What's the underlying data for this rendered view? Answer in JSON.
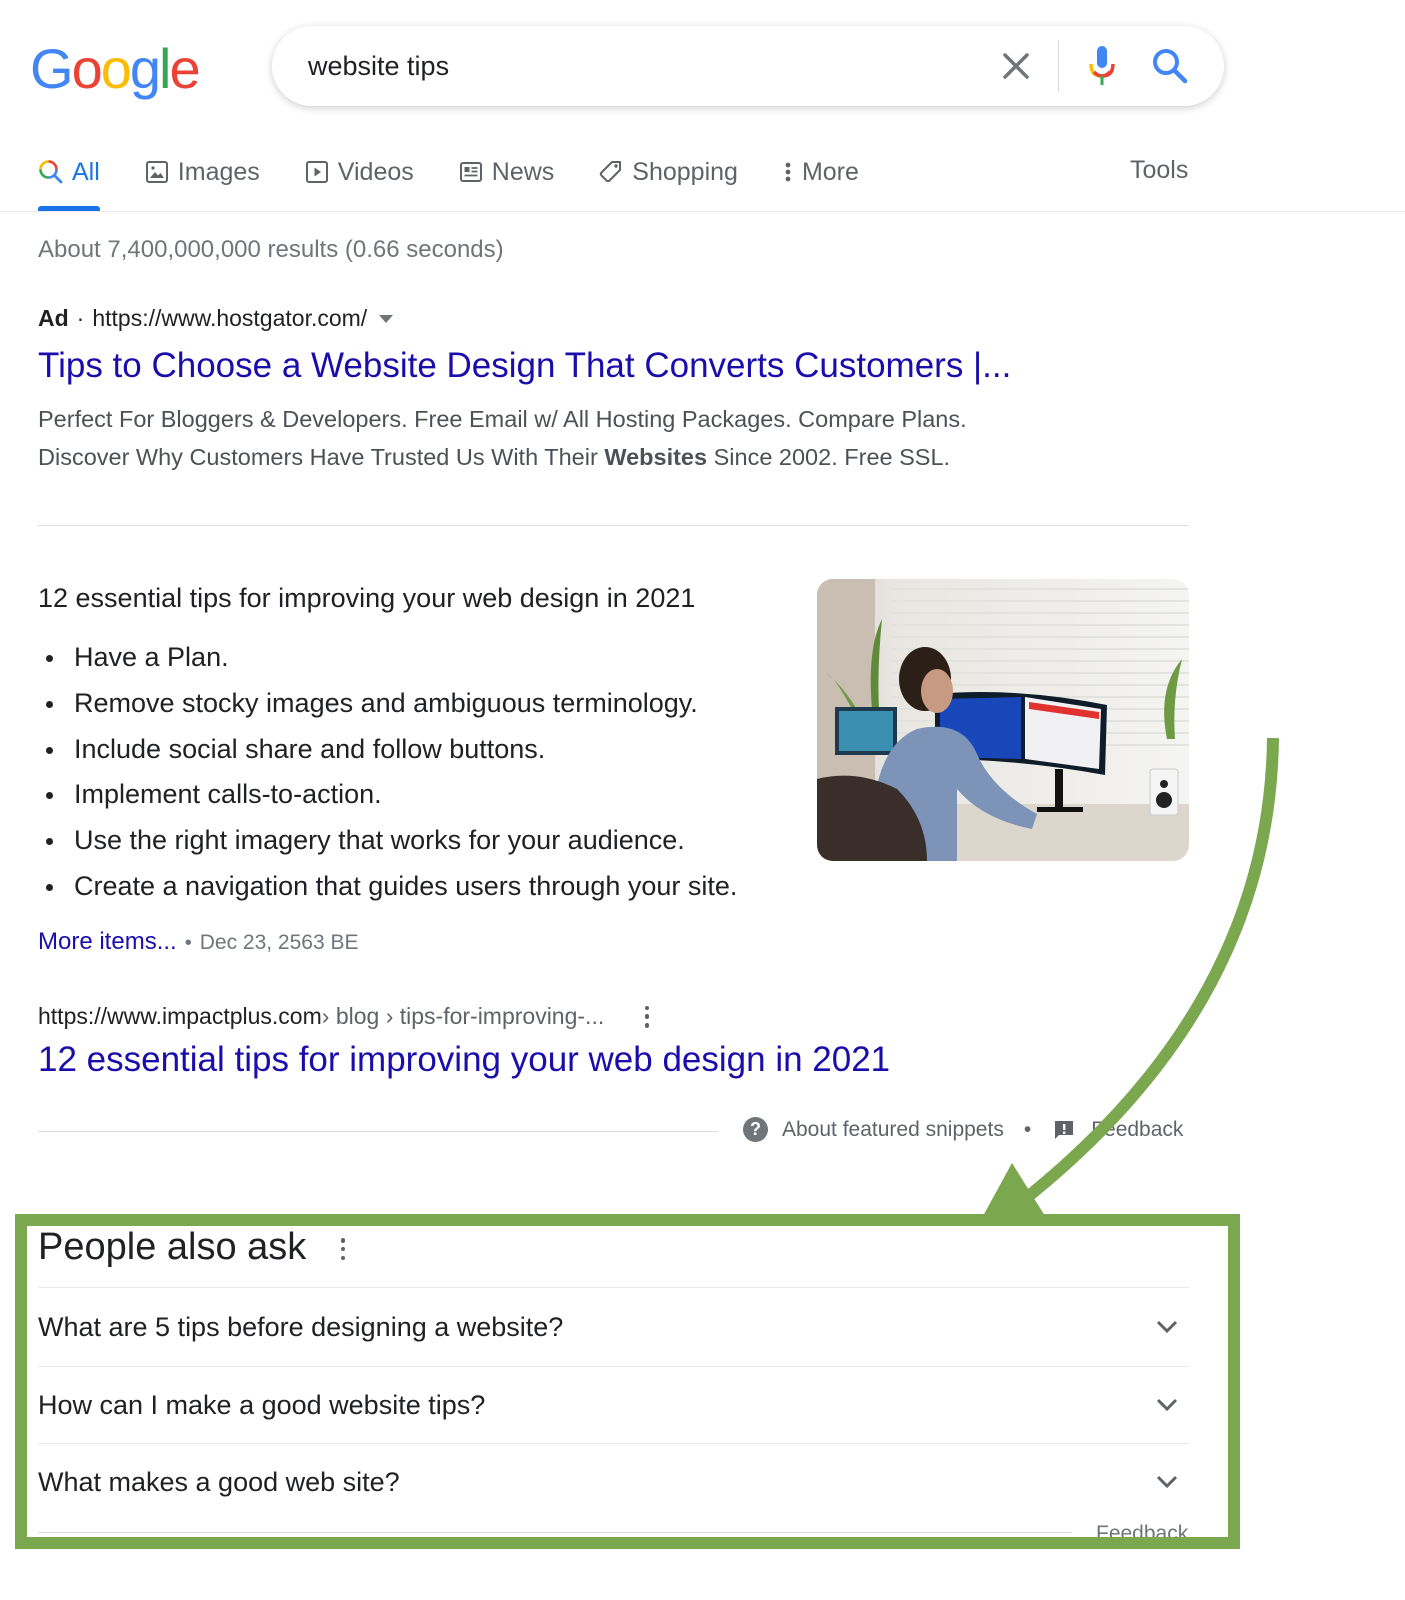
{
  "header": {
    "logo_letters": [
      {
        "char": "G",
        "color": "#4285F4"
      },
      {
        "char": "o",
        "color": "#EA4335"
      },
      {
        "char": "o",
        "color": "#FBBC05"
      },
      {
        "char": "g",
        "color": "#4285F4"
      },
      {
        "char": "l",
        "color": "#34A853"
      },
      {
        "char": "e",
        "color": "#EA4335"
      }
    ],
    "search_query": "website tips",
    "icons": {
      "clear": "close-icon",
      "voice": "microphone-icon",
      "search": "search-icon"
    }
  },
  "tabs": [
    {
      "label": "All",
      "icon": "search-icon",
      "active": true
    },
    {
      "label": "Images",
      "icon": "image-icon",
      "active": false
    },
    {
      "label": "Videos",
      "icon": "play-icon",
      "active": false
    },
    {
      "label": "News",
      "icon": "newspaper-icon",
      "active": false
    },
    {
      "label": "Shopping",
      "icon": "tag-icon",
      "active": false
    },
    {
      "label": "More",
      "icon": "more-vert-icon",
      "active": false
    }
  ],
  "tools_label": "Tools",
  "result_stats": "About 7,400,000,000 results (0.66 seconds)",
  "ad": {
    "badge": "Ad",
    "separator": "·",
    "url": "https://www.hostgator.com/",
    "title": "Tips to Choose a Website Design That Converts Customers |...",
    "description_line1": "Perfect For Bloggers & Developers. Free Email w/ All Hosting Packages. Compare Plans.",
    "description_line2_before": "Discover Why Customers Have Trusted Us With Their ",
    "description_line2_bold": "Websites",
    "description_line2_after": " Since 2002. Free SSL."
  },
  "featured_snippet": {
    "heading": "12 essential tips for improving your web design in 2021",
    "items": [
      "Have a Plan.",
      "Remove stocky images and ambiguous terminology.",
      "Include social share and follow buttons.",
      "Implement calls-to-action.",
      "Use the right imagery that works for your audience.",
      "Create a navigation that guides users through your site."
    ],
    "image_alt": "Man working at desk with curved monitor and laptop",
    "more_items_label": "More items...",
    "date_separator": "•",
    "date": "Dec 23, 2563 BE",
    "cite_domain": "https://www.impactplus.com",
    "cite_path": " › blog › tips-for-improving-...",
    "title": "12 essential tips for improving your web design in 2021",
    "about_label": "About featured snippets",
    "footer_separator": "•",
    "feedback_label": "Feedback"
  },
  "people_also_ask": {
    "title": "People also ask",
    "questions": [
      "What are 5 tips before designing a website?",
      "How can I make a good website tips?",
      "What makes a good web site?"
    ],
    "feedback_label": "Feedback"
  },
  "annotation": {
    "color": "#7BA74F"
  }
}
